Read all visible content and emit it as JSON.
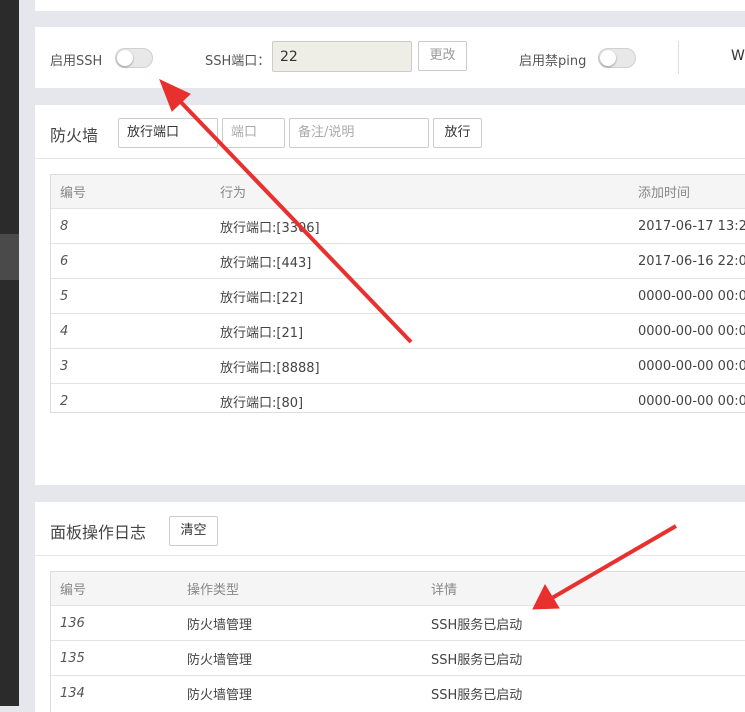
{
  "ssh": {
    "enable_label": "启用SSH",
    "port_label": "SSH端口：",
    "port_value": "22",
    "change_button": "更改",
    "ping_label": "启用禁ping",
    "trailing_text": "W"
  },
  "firewall": {
    "title": "防火墙",
    "type_select": "放行端口",
    "port_placeholder": "端口",
    "note_placeholder": "备注/说明",
    "submit_button": "放行",
    "columns": [
      "编号",
      "行为",
      "添加时间"
    ],
    "rows": [
      {
        "id": "8",
        "action": "放行端口:[3306]",
        "time": "2017-06-17 13:2"
      },
      {
        "id": "6",
        "action": "放行端口:[443]",
        "time": "2017-06-16 22:0"
      },
      {
        "id": "5",
        "action": "放行端口:[22]",
        "time": "0000-00-00 00:0"
      },
      {
        "id": "4",
        "action": "放行端口:[21]",
        "time": "0000-00-00 00:0"
      },
      {
        "id": "3",
        "action": "放行端口:[8888]",
        "time": "0000-00-00 00:0"
      },
      {
        "id": "2",
        "action": "放行端口:[80]",
        "time": "0000-00-00 00:0"
      }
    ]
  },
  "log": {
    "title": "面板操作日志",
    "clear_button": "清空",
    "columns": [
      "编号",
      "操作类型",
      "详情"
    ],
    "rows": [
      {
        "id": "136",
        "type": "防火墙管理",
        "detail": "SSH服务已启动"
      },
      {
        "id": "135",
        "type": "防火墙管理",
        "detail": "SSH服务已启动"
      },
      {
        "id": "134",
        "type": "防火墙管理",
        "detail": "SSH服务已启动"
      }
    ]
  },
  "colors": {
    "annotation_arrow": "#e8312f",
    "toggle_off": "#e8e8e8"
  }
}
